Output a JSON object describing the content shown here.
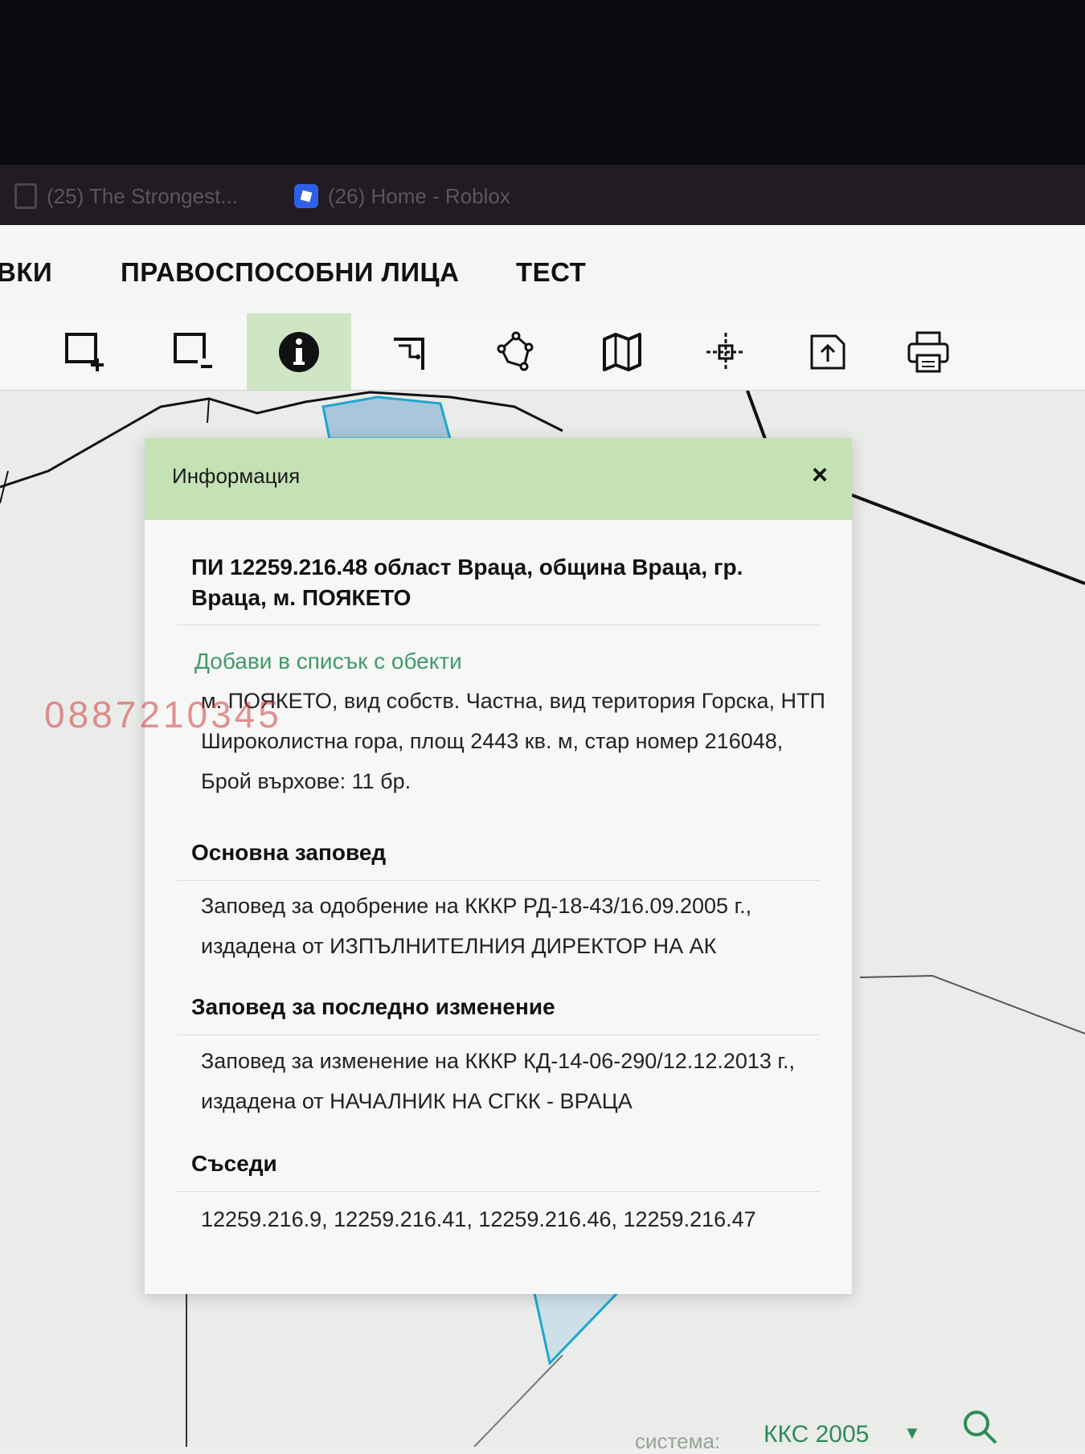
{
  "browser_tabs": [
    {
      "label": "(25) The Strongest..."
    },
    {
      "label": "(26) Home - Roblox"
    }
  ],
  "nav": {
    "items": [
      "ВКИ",
      "ПРАВОСПОСОБНИ ЛИЦА",
      "ТЕСТ"
    ]
  },
  "toolbar": {
    "tools": [
      {
        "icon": "add-selection-icon"
      },
      {
        "icon": "remove-selection-icon"
      },
      {
        "icon": "info-icon",
        "active": true
      },
      {
        "icon": "measure-distance-icon"
      },
      {
        "icon": "measure-area-icon"
      },
      {
        "icon": "map-layers-icon"
      },
      {
        "icon": "coordinates-icon"
      },
      {
        "icon": "export-icon"
      },
      {
        "icon": "print-icon"
      }
    ]
  },
  "popup": {
    "title": "Информация",
    "close_label": "×",
    "property_heading": "ПИ 12259.216.48 област Враца, община Враца, гр. Враца, м. ПОЯКЕТО",
    "add_link": "Добави в списък с обекти",
    "details": "м. ПОЯКЕТО, вид собств. Частна, вид територия Горска, НТП Широколистна гора, площ 2443 кв. м, стар номер 216048, Брой върхове: 11 бр.",
    "main_order_title": "Основна заповед",
    "main_order_text": "Заповед за одобрение на КККР РД-18-43/16.09.2005 г., издадена от ИЗПЪЛНИТЕЛНИЯ ДИРЕКТОР НА АК",
    "last_change_title": "Заповед за последно изменение",
    "last_change_text": "Заповед за изменение на КККР КД-14-06-290/12.12.2013 г., издадена от НАЧАЛНИК НА СГКК - ВРАЦА",
    "neighbors_title": "Съседи",
    "neighbors_text": "12259.216.9, 12259.216.41, 12259.216.46, 12259.216.47"
  },
  "watermark": "0887210345",
  "footer": {
    "label": "система:",
    "value": "ККС 2005",
    "caret": "▼"
  },
  "colors": {
    "accent_green": "#c5e2b4",
    "link_green": "#3f9a68",
    "parcel_fill": "#a9c6da",
    "parcel_stroke": "#1ea7cf"
  }
}
